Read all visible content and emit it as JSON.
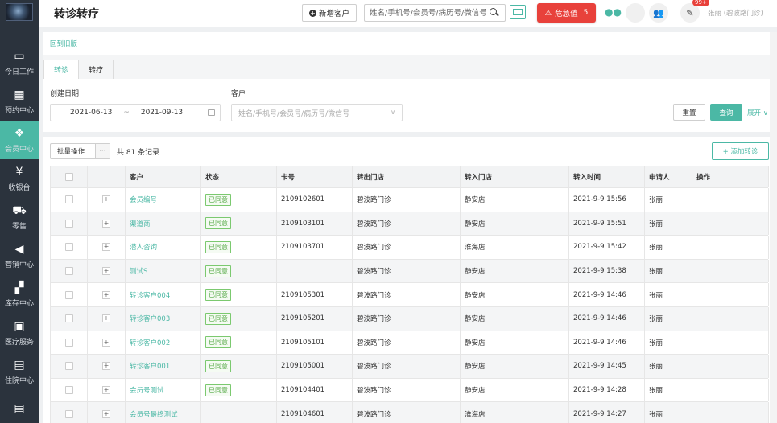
{
  "sidebar": {
    "items": [
      {
        "icon": "laptop-icon",
        "glyph": "▭",
        "label": "今日工作"
      },
      {
        "icon": "calendar-icon",
        "glyph": "▦",
        "label": "预约中心"
      },
      {
        "icon": "members-icon",
        "glyph": "❖",
        "label": "会员中心"
      },
      {
        "icon": "yen-icon",
        "glyph": "¥",
        "label": "收银台"
      },
      {
        "icon": "cart-icon",
        "glyph": "⛟",
        "label": "零售"
      },
      {
        "icon": "megaphone-icon",
        "glyph": "◀",
        "label": "营销中心"
      },
      {
        "icon": "grid-icon",
        "glyph": "▞",
        "label": "库存中心"
      },
      {
        "icon": "medkit-icon",
        "glyph": "▣",
        "label": "医疗服务"
      },
      {
        "icon": "hospital-icon",
        "glyph": "▤",
        "label": "住院中心"
      },
      {
        "icon": "building-icon",
        "glyph": "▤",
        "label": ""
      }
    ],
    "active_index": 2
  },
  "header": {
    "title": "转诊转疗",
    "new_customer": "新增客户",
    "search_placeholder": "姓名/手机号/会员号/病历号/微信号",
    "critical_label": "危急值",
    "critical_count": "5",
    "notif_badge": "99+",
    "user": "张丽 (碧波路门诊)"
  },
  "main": {
    "back_link": "回到旧版",
    "tabs": [
      "转诊",
      "转疗"
    ],
    "active_tab": 0,
    "filter": {
      "date_label": "创建日期",
      "date_start": "2021-06-13",
      "date_sep": "~",
      "date_end": "2021-09-13",
      "customer_label": "客户",
      "customer_placeholder": "姓名/手机号/会员号/病历号/微信号",
      "reset": "重置",
      "query": "查询",
      "expand": "展开 ∨"
    },
    "toolbar": {
      "batch": "批量操作",
      "more": "···",
      "total": "共 81 条记录",
      "add": "+ 添加转诊"
    },
    "table": {
      "columns": [
        "客户",
        "状态",
        "卡号",
        "转出门店",
        "转入门店",
        "转入时间",
        "申请人",
        "操作"
      ],
      "rows": [
        {
          "customer": "会员编号",
          "status": "已同意",
          "card": "2109102601",
          "out": "碧波路门诊",
          "in": "静安店",
          "time": "2021-9-9 15:56",
          "applicant": "张丽"
        },
        {
          "customer": "渠道商",
          "status": "已同意",
          "card": "2109103101",
          "out": "碧波路门诊",
          "in": "静安店",
          "time": "2021-9-9 15:51",
          "applicant": "张丽"
        },
        {
          "customer": "潜人咨询",
          "status": "已同意",
          "card": "2109103701",
          "out": "碧波路门诊",
          "in": "淮海店",
          "time": "2021-9-9 15:42",
          "applicant": "张丽"
        },
        {
          "customer": "测试S",
          "status": "已同意",
          "card": "",
          "out": "碧波路门诊",
          "in": "静安店",
          "time": "2021-9-9 15:38",
          "applicant": "张丽"
        },
        {
          "customer": "转诊客户004",
          "status": "已同意",
          "card": "2109105301",
          "out": "碧波路门诊",
          "in": "静安店",
          "time": "2021-9-9 14:46",
          "applicant": "张丽"
        },
        {
          "customer": "转诊客户003",
          "status": "已同意",
          "card": "2109105201",
          "out": "碧波路门诊",
          "in": "静安店",
          "time": "2021-9-9 14:46",
          "applicant": "张丽"
        },
        {
          "customer": "转诊客户002",
          "status": "已同意",
          "card": "2109105101",
          "out": "碧波路门诊",
          "in": "静安店",
          "time": "2021-9-9 14:46",
          "applicant": "张丽"
        },
        {
          "customer": "转诊客户001",
          "status": "已同意",
          "card": "2109105001",
          "out": "碧波路门诊",
          "in": "静安店",
          "time": "2021-9-9 14:45",
          "applicant": "张丽"
        },
        {
          "customer": "会员号测试",
          "status": "已同意",
          "card": "2109104401",
          "out": "碧波路门诊",
          "in": "静安店",
          "time": "2021-9-9 14:28",
          "applicant": "张丽"
        },
        {
          "customer": "会员号最终测试",
          "status": "",
          "card": "2109104601",
          "out": "碧波路门诊",
          "in": "淮海店",
          "time": "2021-9-9 14:27",
          "applicant": "张丽"
        }
      ]
    }
  },
  "colors": {
    "accent": "#4bb8a5",
    "danger": "#e8413b",
    "sidebar": "#2b333d"
  }
}
